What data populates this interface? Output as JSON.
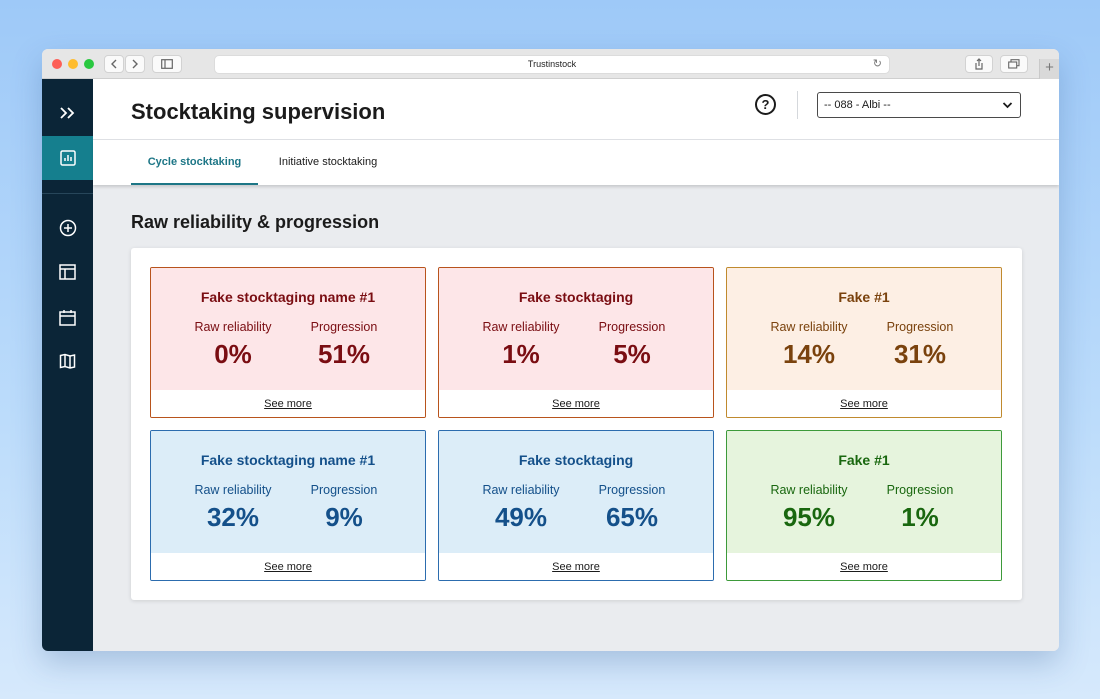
{
  "browser": {
    "url_title": "Trustinstock",
    "back_icon": "chevron-left-icon",
    "forward_icon": "chevron-right-icon",
    "sidebar_toggle_icon": "sidebar-icon",
    "reload_icon": "reload-icon",
    "share_icon": "share-icon",
    "tabs_icon": "tabs-icon",
    "new_tab_symbol": "+"
  },
  "sidebar": {
    "items": [
      {
        "icon": "expand-chevrons-icon"
      },
      {
        "icon": "report-chart-icon",
        "active": true
      },
      {
        "icon": "add-circle-icon"
      },
      {
        "icon": "layout-table-icon"
      },
      {
        "icon": "calendar-icon"
      },
      {
        "icon": "map-book-icon"
      }
    ]
  },
  "header": {
    "title": "Stocktaking supervision",
    "help_symbol": "?",
    "store_select_value": "-- 088 - Albi --"
  },
  "tabs": [
    {
      "label": "Cycle stocktaking",
      "active": true
    },
    {
      "label": "Initiative stocktaking",
      "active": false
    }
  ],
  "section": {
    "title": "Raw reliability & progression"
  },
  "metric_labels": {
    "raw": "Raw reliability",
    "progression": "Progression"
  },
  "cards": [
    {
      "title": "Fake stocktaging name #1",
      "raw": "0%",
      "progression": "51%",
      "see_more": "See more",
      "bg": "#fde6e8",
      "border": "#b8531c",
      "text": "#7a0d12"
    },
    {
      "title": "Fake stocktaging",
      "raw": "1%",
      "progression": "5%",
      "see_more": "See more",
      "bg": "#fde6e8",
      "border": "#b8531c",
      "text": "#7a0d12"
    },
    {
      "title": "Fake #1",
      "raw": "14%",
      "progression": "31%",
      "see_more": "See more",
      "bg": "#fdefe4",
      "border": "#c08a2e",
      "text": "#7a420d"
    },
    {
      "title": "Fake stocktaging name #1",
      "raw": "32%",
      "progression": "9%",
      "see_more": "See more",
      "bg": "#dcedf8",
      "border": "#2c6cae",
      "text": "#14508a"
    },
    {
      "title": "Fake stocktaging",
      "raw": "49%",
      "progression": "65%",
      "see_more": "See more",
      "bg": "#dcedf8",
      "border": "#2c6cae",
      "text": "#14508a"
    },
    {
      "title": "Fake #1",
      "raw": "95%",
      "progression": "1%",
      "see_more": "See more",
      "bg": "#e6f4dd",
      "border": "#3d9a3a",
      "text": "#19670f"
    }
  ],
  "colors": {
    "sidebar_bg": "#0b2537",
    "sidebar_active": "#157f8e",
    "tab_accent": "#1d7686"
  }
}
